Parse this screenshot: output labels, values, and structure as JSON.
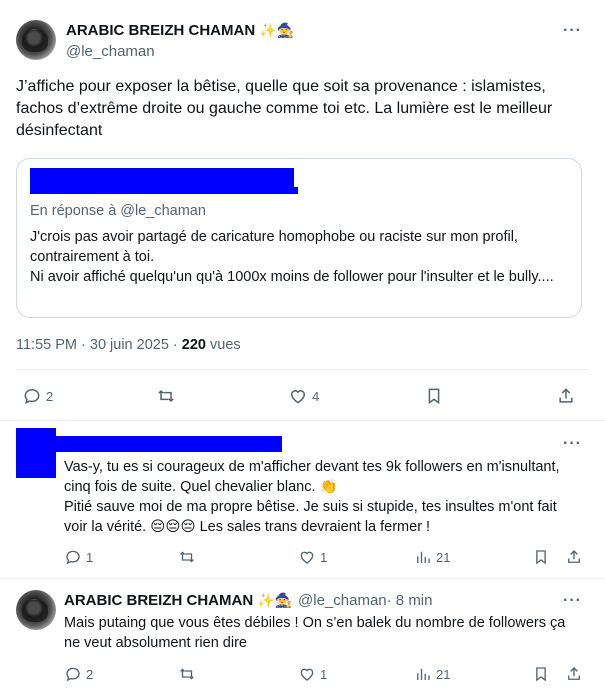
{
  "main_tweet": {
    "author_name": "ARABIC BREIZH CHAMAN",
    "author_emojis": "✨🧙",
    "handle": "@le_chaman",
    "more_label": "···",
    "text": "J’affiche pour exposer la bêtise, quelle que soit sa provenance : islamistes, fachos d’extrême droite ou gauche comme toi etc. La lumière est le meilleur désinfectant",
    "quote": {
      "reply_to": "En réponse à @le_chaman",
      "line1": "J'crois pas avoir partagé de caricature homophobe ou raciste sur mon profil, contrairement à toi.",
      "line2": "Ni avoir affiché quelqu'un qu'à 1000x moins de follower pour l'insulter et le bully...."
    },
    "timestamp": "11:55 PM · 30 juin 2025 · ",
    "views_count": "220",
    "views_label": " vues",
    "actions": {
      "replies": "2",
      "retweets": "",
      "likes": "4"
    }
  },
  "reply1": {
    "more_label": "···",
    "text_line1": "Vas-y, tu es si courageux de m'afficher devant tes 9k followers en m'isnultant, cinq fois de suite. Quel chevalier blanc. 👏",
    "text_line2": "Pitié sauve moi de ma propre bêtise. Je suis si stupide, tes insultes m'ont fait voir la vérité. 😔😔😔 Les sales trans devraient la fermer !",
    "actions": {
      "replies": "1",
      "likes": "1",
      "views": "21"
    }
  },
  "reply2": {
    "author_name": "ARABIC BREIZH CHAMAN",
    "author_emojis": "✨🧙",
    "handle": "@le_chaman",
    "time": " · 8 min",
    "more_label": "···",
    "text": "Mais putaing que vous êtes débiles ! On s’en balek du nombre de followers ça ne veut absolument rien dire",
    "actions": {
      "replies": "2",
      "likes": "1",
      "views": "21"
    }
  },
  "colors": {
    "text": "#0f1419",
    "muted": "#536471",
    "border": "#cfd9de",
    "redaction": "#0000ff"
  }
}
